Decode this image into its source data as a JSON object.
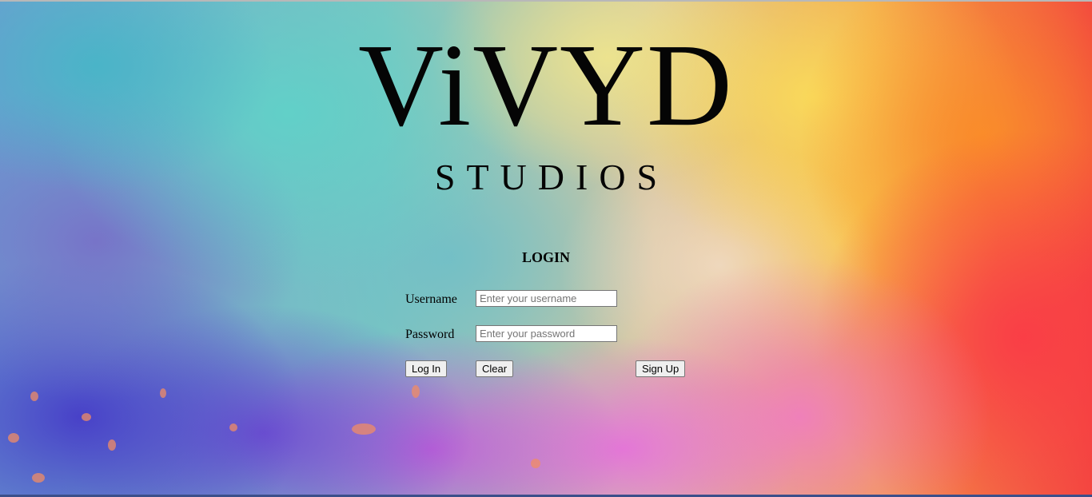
{
  "brand": {
    "title": "ViVYD",
    "subtitle": "STUDIOS"
  },
  "login": {
    "heading": "LOGIN",
    "username_label": "Username",
    "username_placeholder": "Enter your username",
    "username_value": "",
    "password_label": "Password",
    "password_placeholder": "Enter your password",
    "password_value": "",
    "login_button": "Log In",
    "clear_button": "Clear",
    "signup_button": "Sign Up"
  },
  "colors": {
    "text": "#050505",
    "button_bg": "#efefef",
    "input_bg": "#ffffff"
  }
}
